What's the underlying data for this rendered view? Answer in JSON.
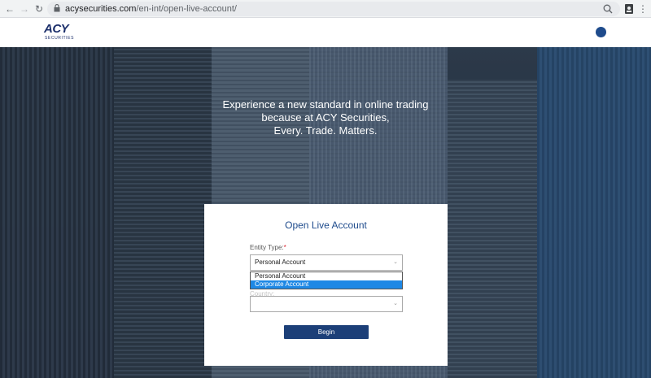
{
  "browser": {
    "url_host": "acysecurities.com",
    "url_path": "/en-int/open-live-account/"
  },
  "header": {
    "logo_text": "ACY",
    "logo_sub": "SECURITIES"
  },
  "hero": {
    "tagline_line1": "Experience a new standard in online trading",
    "tagline_line2": "because at ACY Securities,",
    "tagline_line3": "Every. Trade. Matters."
  },
  "form": {
    "title": "Open Live Account",
    "entity_label": "Entity Type:",
    "entity_required": "*",
    "entity_value": "Personal Account",
    "options": [
      "Personal Account",
      "Corporate Account"
    ],
    "country_label": "Country:",
    "country_value": "",
    "begin_label": "Begin"
  },
  "colors": {
    "brand": "#1c2f6b",
    "title": "#1e4b8c",
    "button": "#1c3f78",
    "option_highlight": "#1e88e5"
  }
}
